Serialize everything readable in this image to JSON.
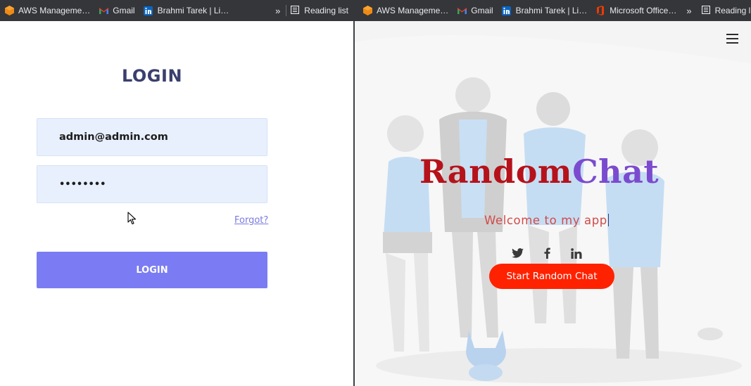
{
  "bookmarks_left": {
    "items": [
      "AWS Manageme…",
      "Gmail",
      "Brahmi Tarek | Li…"
    ],
    "overflow": "»",
    "reading_list": "Reading list"
  },
  "bookmarks_right": {
    "items": [
      "AWS Manageme…",
      "Gmail",
      "Brahmi Tarek | Li…",
      "Microsoft Office…"
    ],
    "overflow": "»",
    "reading_list": "Reading list"
  },
  "login": {
    "title": "LOGIN",
    "email_value": "admin@admin.com",
    "password_mask": "••••••••",
    "forgot_label": "Forgot?",
    "button_label": "LOGIN"
  },
  "app": {
    "brand_part1": "Random",
    "brand_part2": "Chat",
    "welcome": "Welcome to my app",
    "start_button": "Start Random Chat",
    "social_icons": [
      "twitter-icon",
      "facebook-icon",
      "linkedin-icon"
    ]
  },
  "colors": {
    "login_accent": "#7b7cf3",
    "login_title": "#3b3f6e",
    "brand_red": "#b5121b",
    "brand_purple": "#7b4bcf",
    "cta_red": "#ff2200"
  }
}
